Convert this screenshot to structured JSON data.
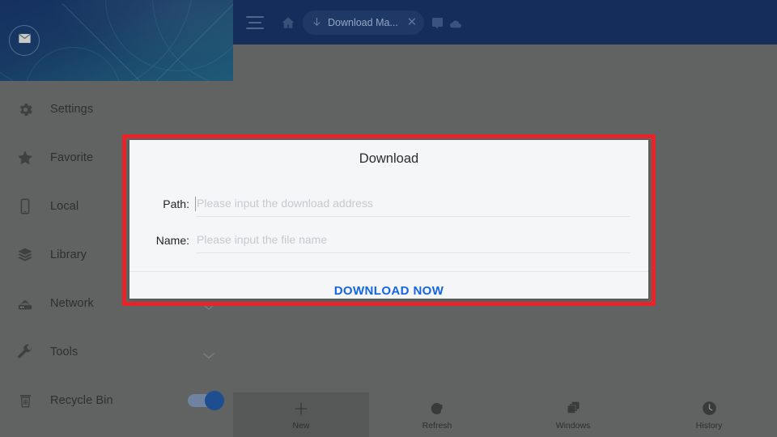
{
  "topbar": {
    "menu_icon": "hamburger-menu-icon",
    "home_icon": "home-icon",
    "tab": {
      "icon": "download-arrow-icon",
      "label": "Download Ma...",
      "close_label": "✕"
    },
    "message_icon": "message-icon",
    "cloud_icon": "cloud-icon",
    "background_color": "#152d5b"
  },
  "sidebar_header": {
    "avatar_icon": "envelope-icon",
    "gradient_from": "#16305f",
    "gradient_to": "#1f5a77"
  },
  "sidebar": {
    "items": [
      {
        "label": "Settings",
        "icon": "gear-icon",
        "chevron": false,
        "toggle": false
      },
      {
        "label": "Favorite",
        "icon": "star-icon",
        "chevron": false,
        "toggle": false
      },
      {
        "label": "Local",
        "icon": "phone-icon",
        "chevron": false,
        "toggle": false
      },
      {
        "label": "Library",
        "icon": "layers-icon",
        "chevron": false,
        "toggle": false
      },
      {
        "label": "Network",
        "icon": "router-icon",
        "chevron": true,
        "toggle": false
      },
      {
        "label": "Tools",
        "icon": "wrench-icon",
        "chevron": true,
        "toggle": false
      },
      {
        "label": "Recycle Bin",
        "icon": "trash-icon",
        "chevron": false,
        "toggle": true
      }
    ],
    "toggle_state": "on",
    "toggle_color": "#1d4e8f"
  },
  "bottombar": {
    "items": [
      {
        "label": "New",
        "icon": "plus-icon",
        "active": true
      },
      {
        "label": "Refresh",
        "icon": "refresh-icon",
        "active": false
      },
      {
        "label": "Windows",
        "icon": "windows-stack-icon",
        "active": false
      },
      {
        "label": "History",
        "icon": "clock-icon",
        "active": false
      }
    ]
  },
  "modal": {
    "title": "Download",
    "highlight_color": "#e8232a",
    "fields": [
      {
        "label": "Path:",
        "value": "",
        "placeholder": "Please input the download address",
        "focused": true
      },
      {
        "label": "Name:",
        "value": "",
        "placeholder": "Please input the file name",
        "focused": false
      }
    ],
    "action_label": "DOWNLOAD NOW",
    "action_color": "#1565e0"
  }
}
